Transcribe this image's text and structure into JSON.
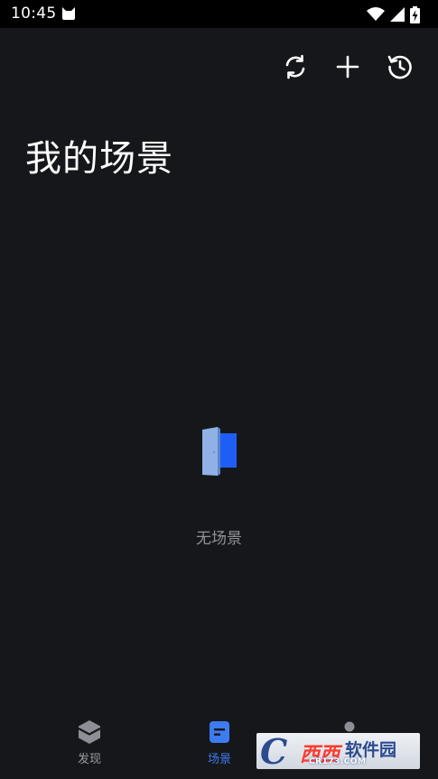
{
  "status_bar": {
    "time": "10:45"
  },
  "header": {
    "actions": [
      {
        "icon": "refresh-icon"
      },
      {
        "icon": "add-icon"
      },
      {
        "icon": "history-clock-icon"
      }
    ],
    "title": "我的场景"
  },
  "empty_state": {
    "icon": "door-icon",
    "text": "无场景"
  },
  "bottom_nav": {
    "items": [
      {
        "label": "发现",
        "icon": "discover-cube-icon",
        "active": false
      },
      {
        "label": "场景",
        "icon": "scene-document-icon",
        "active": true
      },
      {
        "label": "",
        "icon": "person-icon",
        "active": false
      }
    ]
  },
  "watermark": {
    "mark": "C",
    "brand": "西西",
    "name": "软件园",
    "url": "CR173.COM"
  },
  "colors": {
    "background": "#16171b",
    "accent": "#3d7bf0",
    "muted_text": "#8f9296"
  }
}
